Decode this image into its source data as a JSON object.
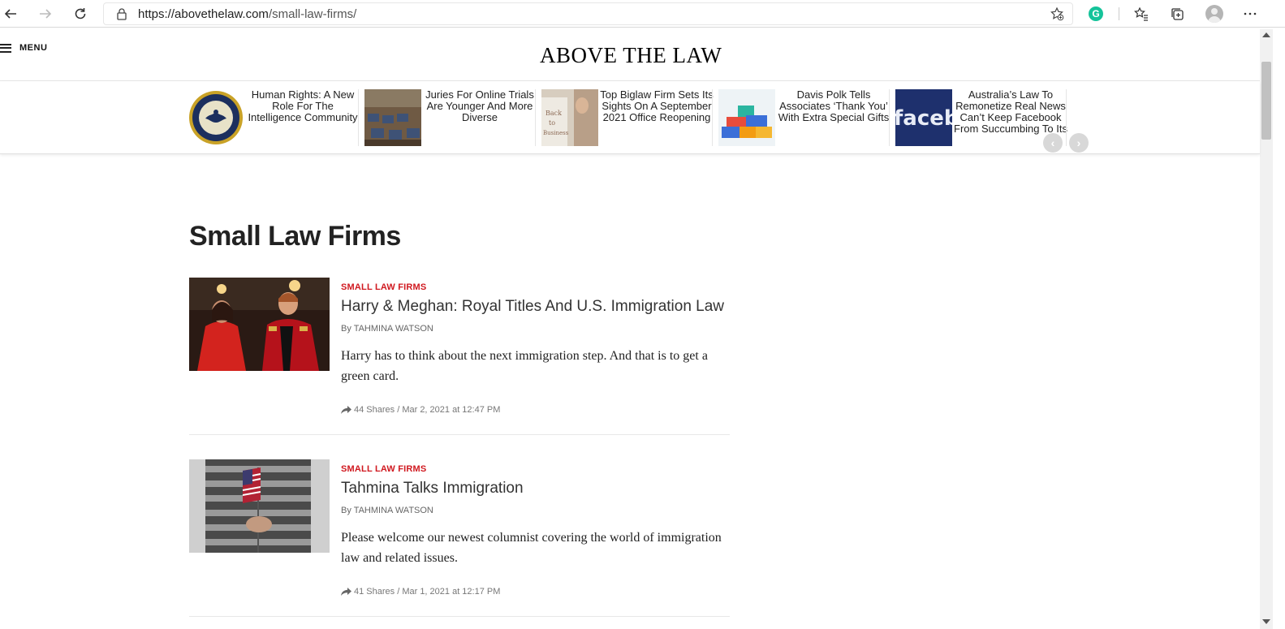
{
  "browser": {
    "url_host": "https://abovethelaw.com",
    "url_path": "/small-law-firms/",
    "grammarly_letter": "G"
  },
  "header": {
    "menu_label": "MENU",
    "logo_text": "ABOVE THE LAW"
  },
  "trending": [
    {
      "title": "Human Rights: A New Role For The Intelligence Community",
      "thumb": "seal-icon"
    },
    {
      "title": "Juries For Online Trials Are Younger And More Diverse",
      "thumb": "courtroom-image"
    },
    {
      "title": "Top Biglaw Firm Sets Its Sights On A September 2021 Office Reopening",
      "thumb": "back-to-business-image"
    },
    {
      "title": "Davis Polk Tells Associates ‘Thank You’ With Extra Special Gifts",
      "thumb": "gift-boxes-image"
    },
    {
      "title": "Australia’s Law To Remonetize Real News Can’t Keep Facebook From Succumbing To Its",
      "thumb": "facebook-image",
      "thumb_text": "faceb"
    }
  ],
  "page_title": "Small Law Firms",
  "articles": [
    {
      "category": "SMALL LAW FIRMS",
      "title": "Harry & Meghan: Royal Titles And U.S. Immigration Law",
      "byline": "By TAHMINA WATSON",
      "excerpt": "Harry has to think about the next immigration step. And that is to get a green card.",
      "meta": "44 Shares / Mar 2, 2021 at 12:47 PM"
    },
    {
      "category": "SMALL LAW FIRMS",
      "title": "Tahmina Talks Immigration",
      "byline": "By TAHMINA WATSON",
      "excerpt": "Please welcome our newest columnist covering the world of immigration law and related issues.",
      "meta": "41 Shares / Mar 1, 2021 at 12:17 PM"
    }
  ],
  "colors": {
    "category_red": "#d0181f",
    "grammarly_green": "#15c39a"
  }
}
